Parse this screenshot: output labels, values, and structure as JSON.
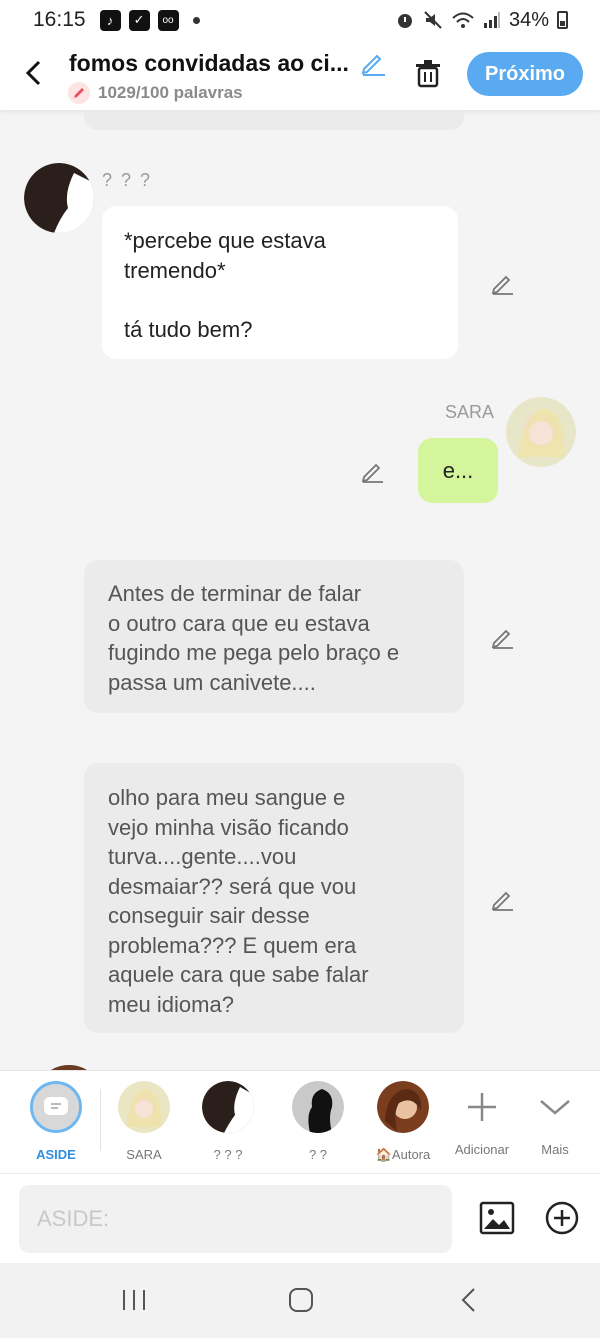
{
  "status_bar": {
    "time": "16:15",
    "battery": "34%"
  },
  "header": {
    "title": "fomos convidadas ao ci...",
    "word_count": "1029/100 palavras",
    "next_label": "Próximo"
  },
  "messages": [
    {
      "speaker": "? ? ?",
      "text": "*percebe que estava\ntremendo*\n\ntá tudo bem?"
    },
    {
      "speaker": "SARA",
      "text": "e..."
    },
    {
      "speaker": "ASIDE",
      "text": "Antes de terminar de falar\no outro cara que eu estava\nfugindo me pega pelo braço e\npassa um canivete...."
    },
    {
      "speaker": "ASIDE",
      "text": "olho para meu sangue e\nvejo minha visão ficando\nturva....gente....vou\ndesmaiar?? será que vou\nconseguir sair desse\nproblema??? E quem era\naquele cara que sabe falar\nmeu idioma?"
    }
  ],
  "characters": [
    {
      "label": "ASIDE"
    },
    {
      "label": "SARA"
    },
    {
      "label": "? ? ?"
    },
    {
      "label": "? ?"
    },
    {
      "label": "🏠Autora"
    }
  ],
  "actions": {
    "add_label": "Adicionar",
    "more_label": "Mais"
  },
  "composer": {
    "placeholder": "ASIDE:"
  },
  "colors": {
    "accent": "#59aaf0",
    "own_bubble": "#d5f59c",
    "narration_bubble": "#ebebeb"
  }
}
